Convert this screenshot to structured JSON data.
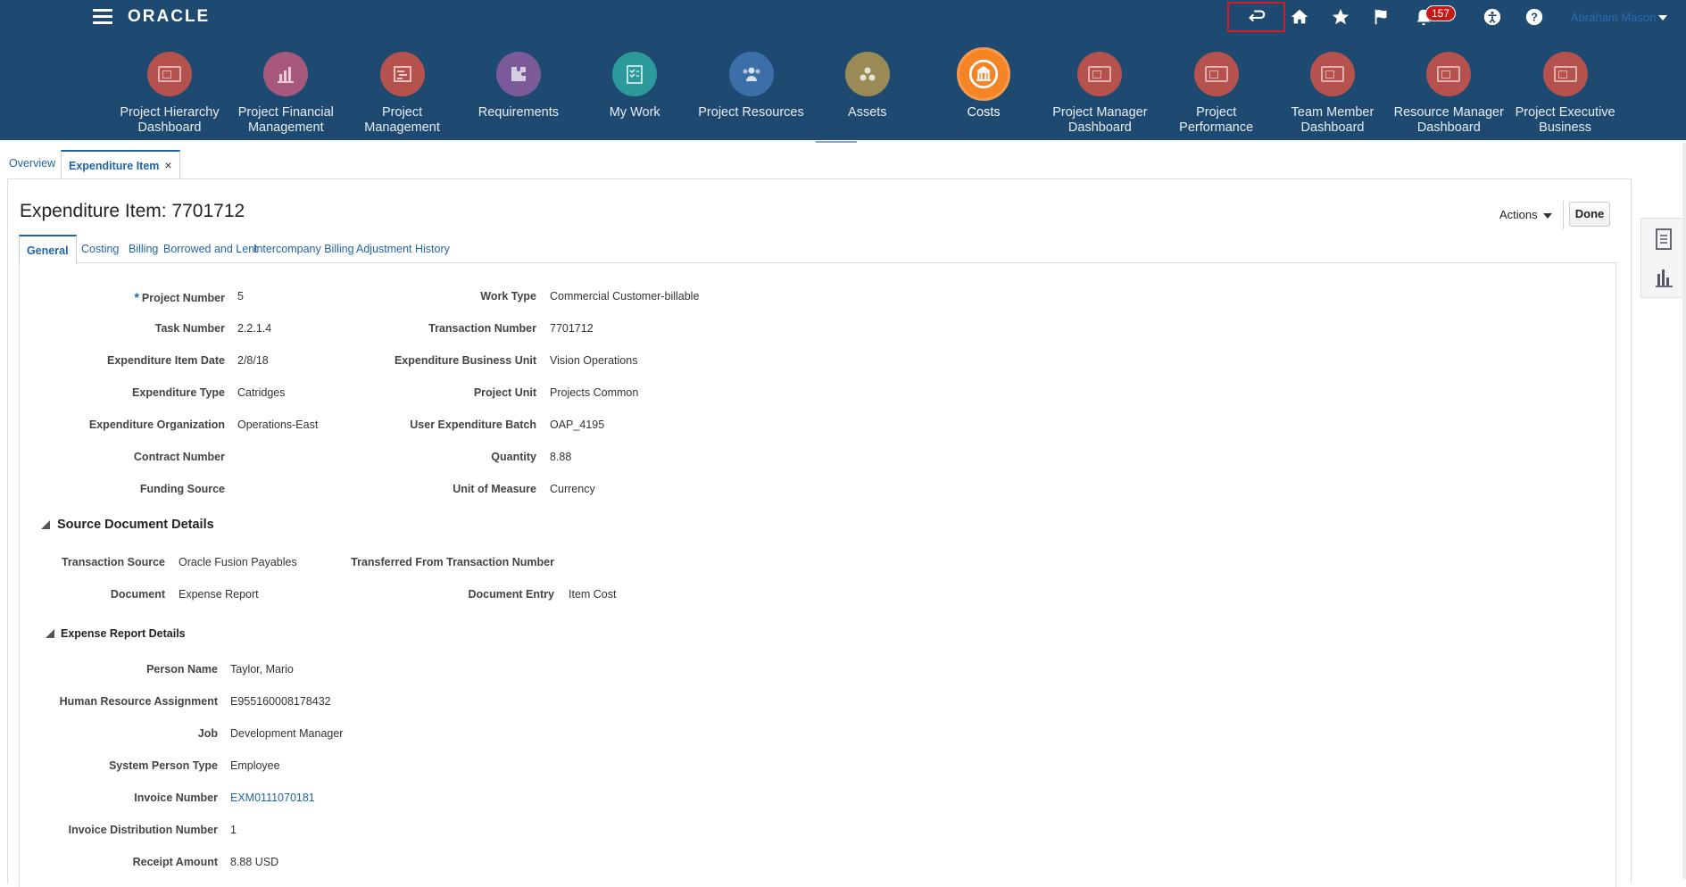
{
  "header": {
    "logo": "ORACLE",
    "notifications_count": "157",
    "user_name": "Abraham Mason"
  },
  "springboard": [
    {
      "label": "Project Hierarchy Dashboard",
      "color": "#b6524d",
      "icon": "dashboard-icon"
    },
    {
      "label": "Project Financial Management",
      "color": "#a8577d",
      "icon": "financial-chart-icon"
    },
    {
      "label": "Project Management",
      "color": "#b6524d",
      "icon": "gantt-icon"
    },
    {
      "label": "Requirements",
      "color": "#7b5a9a",
      "icon": "puzzle-icon"
    },
    {
      "label": "My Work",
      "color": "#2c9a9a",
      "icon": "checklist-icon"
    },
    {
      "label": "Project Resources",
      "color": "#3c6fa8",
      "icon": "people-icon"
    },
    {
      "label": "Assets",
      "color": "#9a8a55",
      "icon": "assets-icon"
    },
    {
      "label": "Costs",
      "color": "#f58426",
      "icon": "bank-icon",
      "selected": true
    },
    {
      "label": "Project Manager Dashboard",
      "color": "#b6524d",
      "icon": "dashboard-icon"
    },
    {
      "label": "Project Performance",
      "color": "#b6524d",
      "icon": "dashboard-icon"
    },
    {
      "label": "Team Member Dashboard",
      "color": "#b6524d",
      "icon": "dashboard-icon"
    },
    {
      "label": "Resource Manager Dashboard",
      "color": "#b6524d",
      "icon": "dashboard-icon"
    },
    {
      "label": "Project Executive Business",
      "color": "#b6524d",
      "icon": "dashboard-icon"
    }
  ],
  "doc_tabs": {
    "overview": "Overview",
    "expenditure_item": "Expenditure Item",
    "close": "×"
  },
  "page": {
    "title": "Expenditure Item: 7701712",
    "actions": "Actions",
    "done": "Done"
  },
  "sub_tabs": [
    "General",
    "Costing",
    "Billing",
    "Borrowed and Lent",
    "Intercompany Billing",
    "Adjustment History"
  ],
  "general": {
    "required_marker": "*",
    "left": [
      {
        "label": "Project Number",
        "value": "5"
      },
      {
        "label": "Task Number",
        "value": "2.2.1.4"
      },
      {
        "label": "Expenditure Item Date",
        "value": "2/8/18"
      },
      {
        "label": "Expenditure Type",
        "value": "Catridges"
      },
      {
        "label": "Expenditure Organization",
        "value": "Operations-East"
      },
      {
        "label": "Contract Number",
        "value": ""
      },
      {
        "label": "Funding Source",
        "value": ""
      }
    ],
    "right": [
      {
        "label": "Work Type",
        "value": "Commercial Customer-billable"
      },
      {
        "label": "Transaction Number",
        "value": "7701712"
      },
      {
        "label": "Expenditure Business Unit",
        "value": "Vision Operations"
      },
      {
        "label": "Project Unit",
        "value": "Projects Common"
      },
      {
        "label": "User Expenditure Batch",
        "value": "OAP_4195"
      },
      {
        "label": "Quantity",
        "value": "8.88"
      },
      {
        "label": "Unit of Measure",
        "value": "Currency"
      }
    ]
  },
  "source_document": {
    "title": "Source Document Details",
    "left": [
      {
        "label": "Transaction Source",
        "value": "Oracle Fusion Payables"
      },
      {
        "label": "Document",
        "value": "Expense Report"
      }
    ],
    "right": [
      {
        "label": "Transferred From Transaction Number",
        "value": ""
      },
      {
        "label": "Document Entry",
        "value": "Item Cost"
      }
    ]
  },
  "expense_report": {
    "title": "Expense Report Details",
    "fields": [
      {
        "label": "Person Name",
        "value": "Taylor, Mario"
      },
      {
        "label": "Human Resource Assignment",
        "value": "E955160008178432"
      },
      {
        "label": "Job",
        "value": "Development Manager"
      },
      {
        "label": "System Person Type",
        "value": "Employee"
      },
      {
        "label": "Invoice Number",
        "value": "EXM0111070181"
      },
      {
        "label": "Invoice Distribution Number",
        "value": "1"
      },
      {
        "label": "Receipt Amount",
        "value": "8.88 USD"
      }
    ]
  }
}
